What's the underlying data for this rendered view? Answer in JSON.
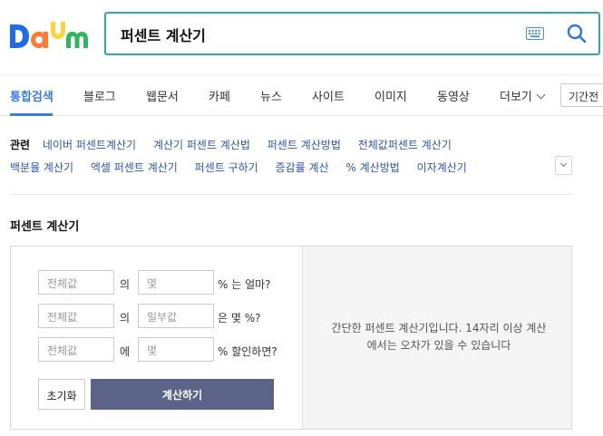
{
  "logo": {
    "text": "Daum",
    "colors": [
      "#1f6ce6",
      "#ff7a35",
      "#ffd43b",
      "#2fb65d",
      "#ee4040"
    ]
  },
  "search": {
    "value": "퍼센트 계산기"
  },
  "icons": {
    "keyboard": "keyboard-icon",
    "search": "search-icon",
    "more": "chevron-down-icon"
  },
  "tabs": [
    "통합검색",
    "블로그",
    "웹문서",
    "카페",
    "뉴스",
    "사이트",
    "이미지",
    "동영상",
    "더보기"
  ],
  "period": "기간전",
  "related": {
    "label": "관련",
    "row1": [
      "네이버 퍼센트계산기",
      "계산기 퍼센트 계산법",
      "퍼센트 계산방법",
      "전체값퍼센트 계산기"
    ],
    "row2": [
      "백분율 계산기",
      "엑셀 퍼센트 계산기",
      "퍼센트 구하기",
      "증감률 계산",
      "% 계산방법",
      "이자계산기"
    ]
  },
  "calculator": {
    "title": "퍼센트 계산기",
    "rows": [
      {
        "input1": "전체값",
        "connector": "의",
        "input2": "몇",
        "suffix": "% 는 얼마?"
      },
      {
        "input1": "전체값",
        "connector": "의",
        "input2": "일부값",
        "suffix": "은 몇 %?"
      },
      {
        "input1": "전체값",
        "connector": "에",
        "input2": "몇",
        "suffix": "% 할인하면?"
      }
    ],
    "reset_label": "초기화",
    "calc_label": "계산하기",
    "info": "간단한 퍼센트 계산기입니다. 14자리 이상 계산에서는 오차가 있을 수 있습니다"
  },
  "colors": {
    "accent": "#3b7ddb",
    "search_border": "#2fa7ad",
    "link": "#2f56b2",
    "calc_button": "#5b6389"
  }
}
